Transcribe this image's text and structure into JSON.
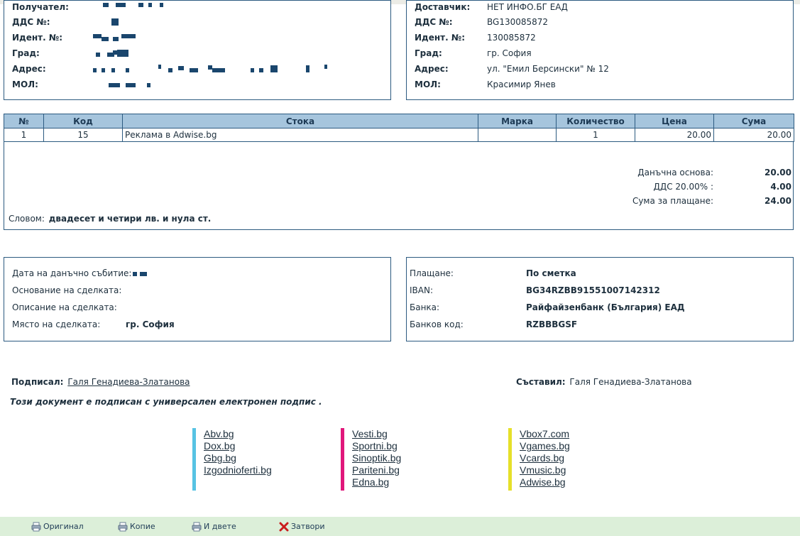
{
  "recipient": {
    "fields": [
      {
        "label": "Получател:"
      },
      {
        "label": "ДДС №:"
      },
      {
        "label": "Идент. №:"
      },
      {
        "label": "Град:"
      },
      {
        "label": "Адрес:"
      },
      {
        "label": "МОЛ:"
      }
    ]
  },
  "supplier": {
    "fields": [
      {
        "label": "Доставчик:",
        "value": "НЕТ ИНФО.БГ ЕАД"
      },
      {
        "label": "ДДС №:",
        "value": "BG130085872"
      },
      {
        "label": "Идент. №:",
        "value": "130085872"
      },
      {
        "label": "Град:",
        "value": "гр. София"
      },
      {
        "label": "Адрес:",
        "value": "ул. \"Емил Берсински\" № 12"
      },
      {
        "label": "МОЛ:",
        "value": "Красимир Янев"
      }
    ]
  },
  "items_table": {
    "headers": [
      "№",
      "Код",
      "Стока",
      "Марка",
      "Количество",
      "Цена",
      "Сума"
    ],
    "rows": [
      {
        "no": "1",
        "code": "15",
        "item": "Реклама в Adwise.bg",
        "brand": "",
        "qty": "1",
        "price": "20.00",
        "sum": "20.00"
      }
    ]
  },
  "totals": {
    "tax_base_label": "Данъчна основа:",
    "tax_base_value": "20.00",
    "vat_label": "ДДС 20.00% :",
    "vat_value": "4.00",
    "total_label": "Сума за плащане:",
    "total_value": "24.00",
    "in_words_label": "Словом:",
    "in_words_value": "двадесет и четири лв. и нула ст."
  },
  "transaction": {
    "fields": [
      {
        "label": "Дата на данъчно събитие:",
        "value": ""
      },
      {
        "label": "Основание на сделката:",
        "value": ""
      },
      {
        "label": "Описание на сделката:",
        "value": ""
      },
      {
        "label": "Място на сделката:",
        "value": "гр. София"
      }
    ]
  },
  "payment": {
    "fields": [
      {
        "label": "Плащане:",
        "value": "По сметка"
      },
      {
        "label": "IBAN:",
        "value": "BG34RZBB91551007142312"
      },
      {
        "label": "Банка:",
        "value": "Райфайзенбанк (България) ЕАД"
      },
      {
        "label": "Банков код:",
        "value": "RZBBBGSF"
      }
    ]
  },
  "signatures": {
    "signed_label": "Подписал:",
    "signed_name": "Галя Генадиева-Златанова",
    "composed_label": "Съставил:",
    "composed_name": "Галя Генадиева-Златанова",
    "e_sign_note": "Този документ е подписан с универсален електронен подпис ."
  },
  "partner_links": {
    "columns": [
      {
        "color": "#57c3e3",
        "items": [
          "Abv.bg",
          "Dox.bg",
          "Gbg.bg",
          "Izgodnioferti.bg"
        ]
      },
      {
        "color": "#e0177b",
        "items": [
          "Vesti.bg",
          "Sportni.bg",
          "Sinoptik.bg",
          "Pariteni.bg",
          "Edna.bg"
        ]
      },
      {
        "color": "#e6e02a",
        "items": [
          "Vbox7.com",
          "Vgames.bg",
          "Vcards.bg",
          "Vmusic.bg",
          "Adwise.bg"
        ]
      }
    ]
  },
  "footer": {
    "original": "Оригинал",
    "copy": "Копие",
    "both": "И двете",
    "close": "Затвори"
  },
  "colors": {
    "border": "#2c5a80",
    "header_bg": "#a6c5dd",
    "footer_bg": "#dcefd9",
    "redaction": "#1a466d"
  }
}
